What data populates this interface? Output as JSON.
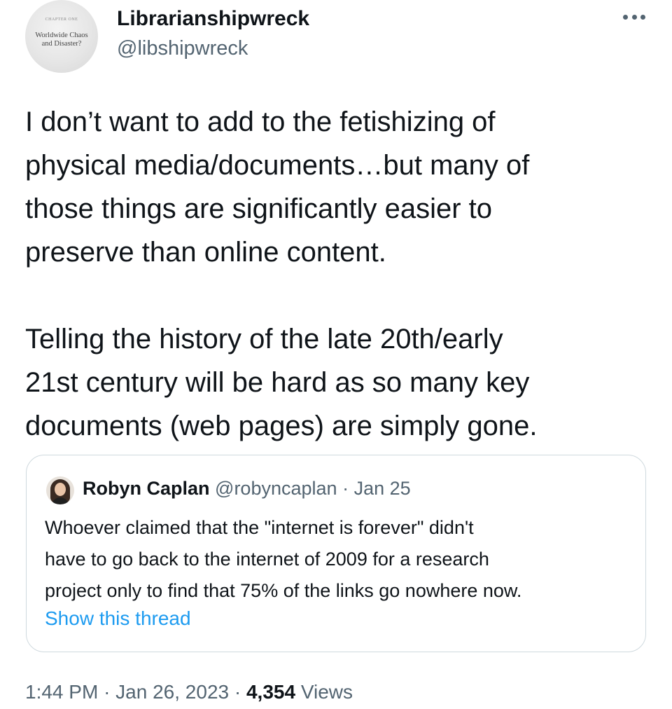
{
  "author": {
    "display_name": "Librarianshipwreck",
    "handle": "@libshipwreck",
    "avatar": {
      "chapter_label": "CHAPTER ONE",
      "title_line1": "Worldwide Chaos",
      "title_line2": "and Disaster?"
    }
  },
  "more_icon": "more-horizontal-icon",
  "tweet": {
    "paragraph1": [
      "I don’t want to add to the fetishizing of",
      "physical media/documents…but many of",
      "those things are significantly easier to",
      "preserve than online content."
    ],
    "paragraph2": [
      "Telling the history of the late 20th/early",
      "21st century will be hard as so many key",
      "documents (web pages) are simply gone."
    ]
  },
  "quote": {
    "display_name": "Robyn Caplan",
    "handle": "@robyncaplan",
    "separator": "·",
    "date": "Jan 25",
    "text_lines": [
      "Whoever claimed that the \"internet is forever\" didn't",
      "have to go back to the internet of 2009 for a research",
      "project only to find that 75% of the links go nowhere now."
    ],
    "show_thread": "Show this thread"
  },
  "footer": {
    "time": "1:44 PM",
    "separator": "·",
    "date": "Jan 26, 2023",
    "views_count": "4,354",
    "views_label": "Views"
  },
  "colors": {
    "text_primary": "#0f1419",
    "text_secondary": "#536471",
    "link": "#1d9bf0",
    "border": "#cfd9de"
  }
}
